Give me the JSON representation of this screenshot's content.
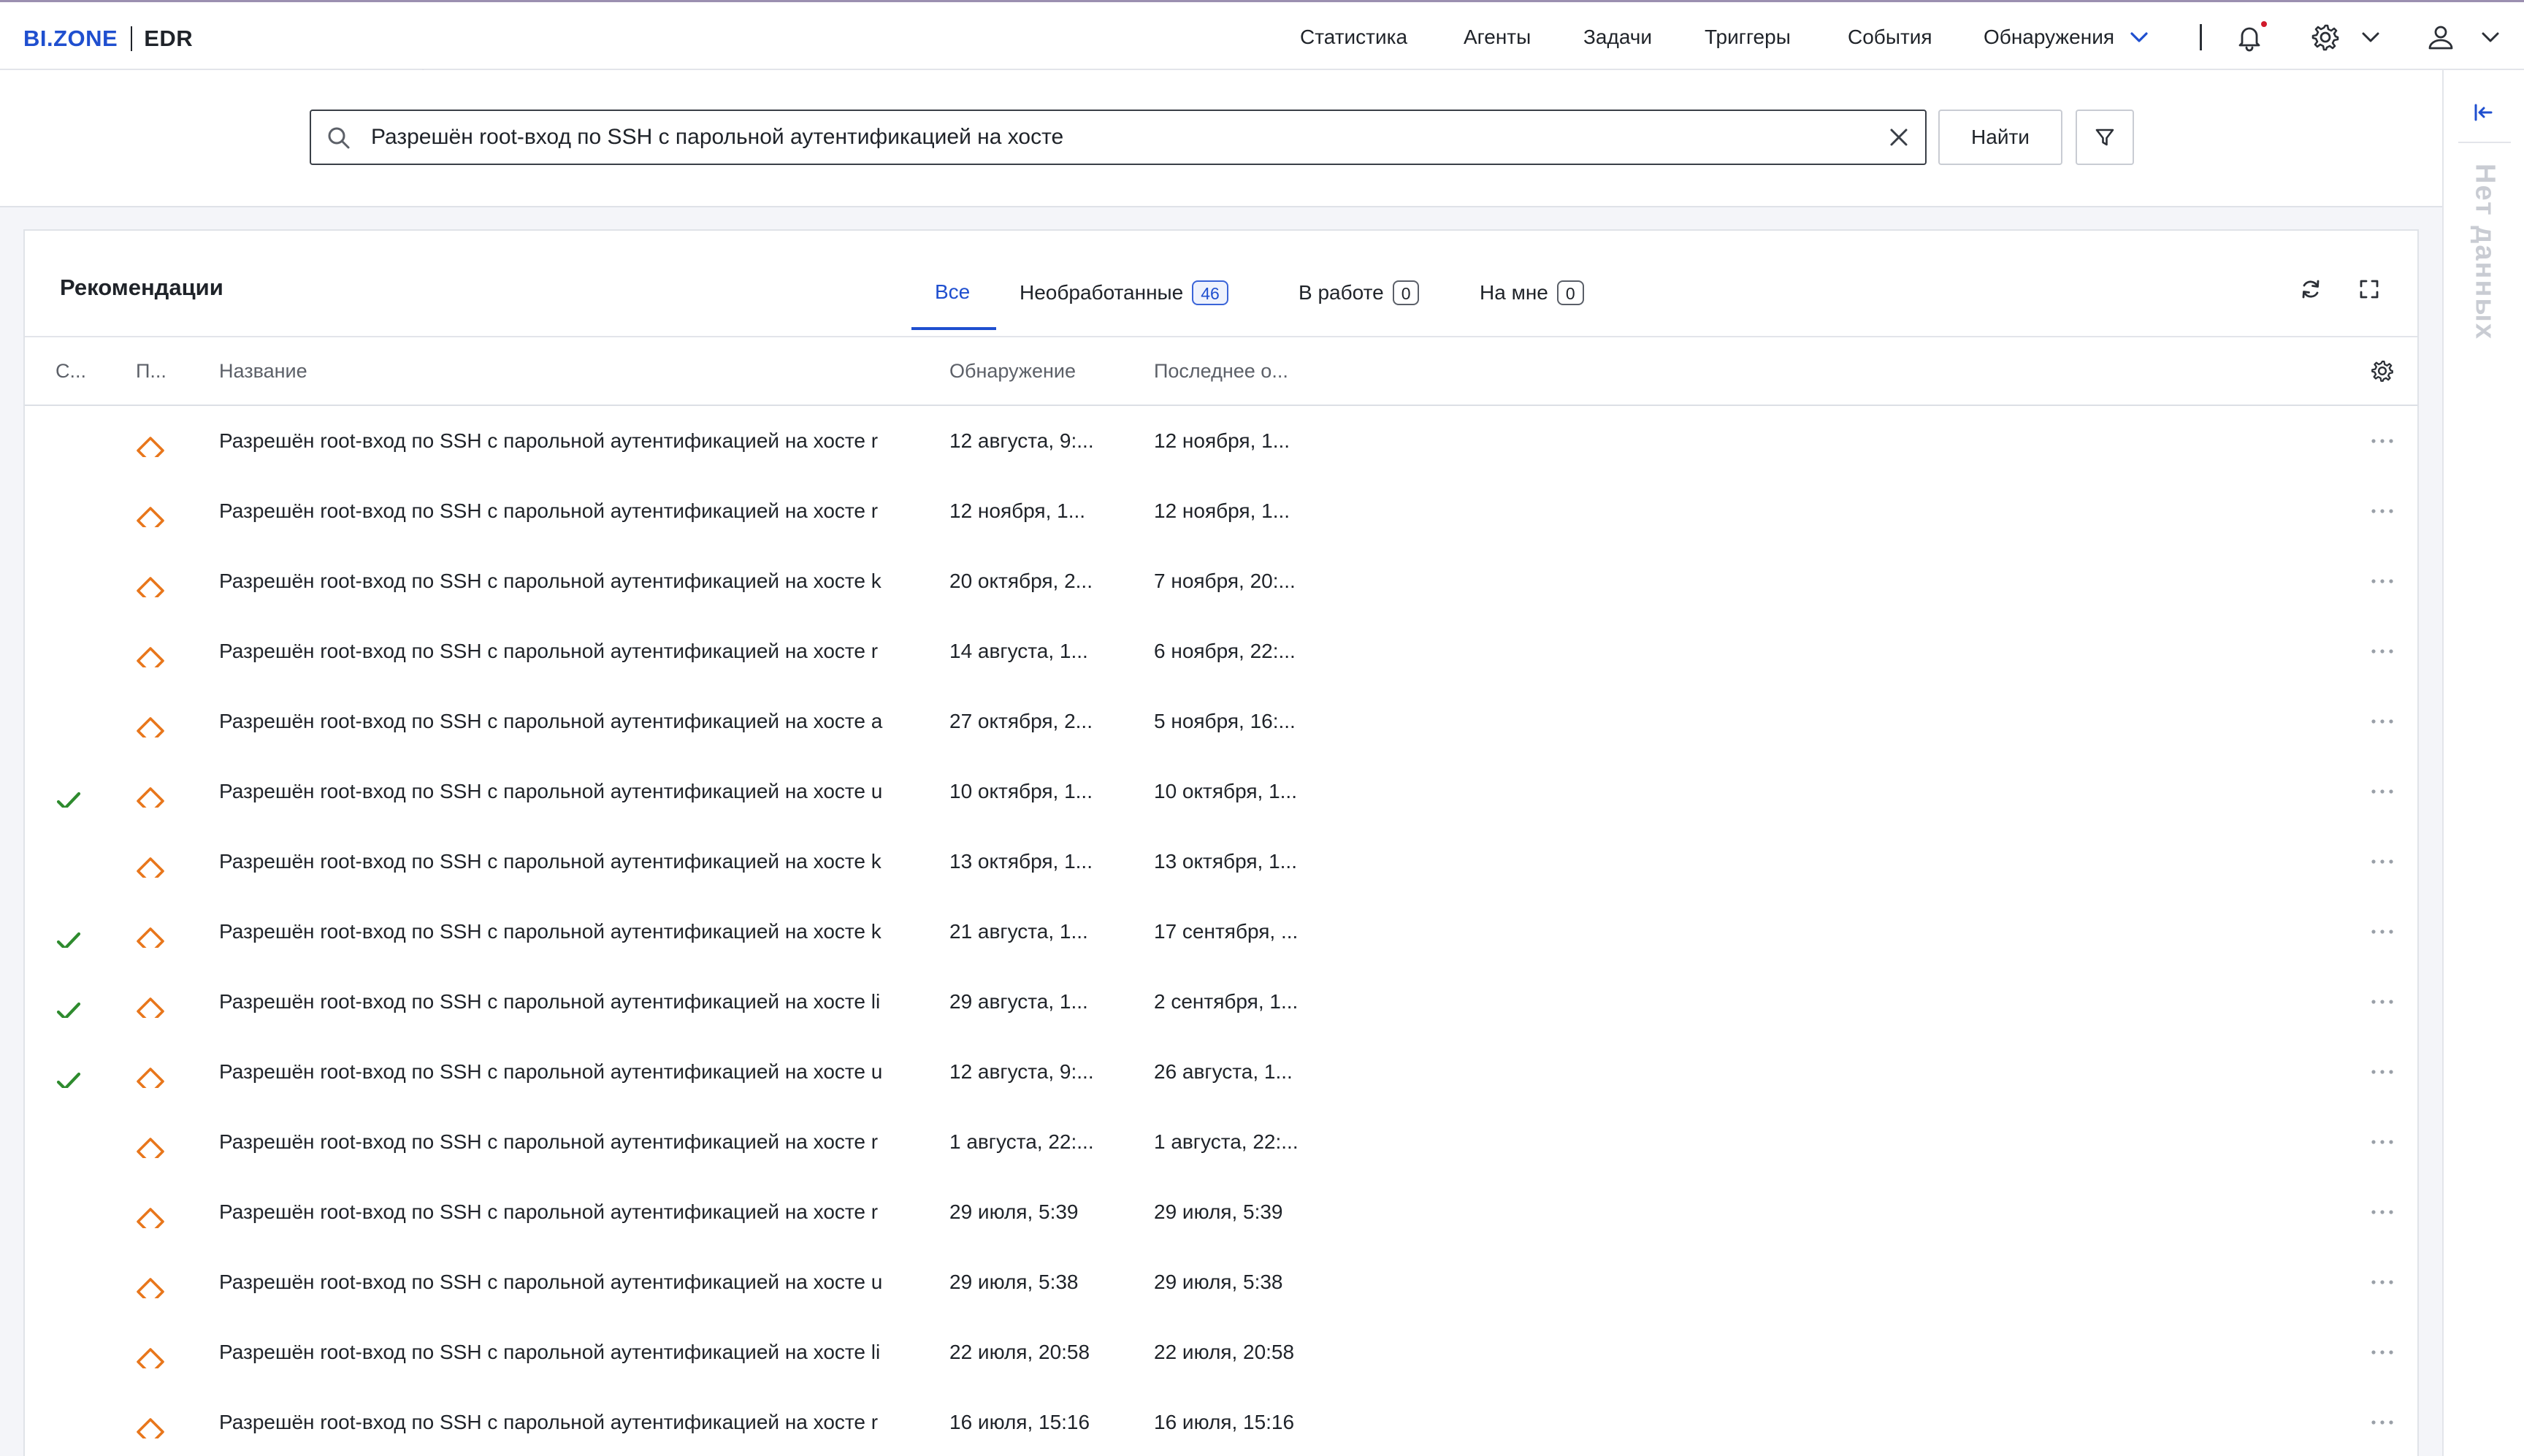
{
  "header": {
    "brand": "BI.ZONE",
    "product": "EDR",
    "nav": [
      "Статистика",
      "Агенты",
      "Задачи",
      "Триггеры",
      "События",
      "Обнаружения"
    ],
    "active_nav": "Обнаружения",
    "icons": [
      "chevron-down-icon",
      "bell-icon",
      "gear-icon",
      "user-icon"
    ]
  },
  "search": {
    "value": "Разрешён root-вход по SSH с парольной аутентификацией на хосте",
    "find_label": "Найти"
  },
  "side_panel": {
    "empty_label": "Нет данных"
  },
  "card": {
    "title": "Рекомендации",
    "tabs": [
      {
        "label": "Все",
        "count": null
      },
      {
        "label": "Необработанные",
        "count": "46"
      },
      {
        "label": "В работе",
        "count": "0"
      },
      {
        "label": "На мне",
        "count": "0"
      }
    ],
    "active_tab": "Все"
  },
  "table": {
    "columns": [
      "С...",
      "П...",
      "Название",
      "Обнаружение",
      "Последнее о..."
    ],
    "rows": [
      {
        "checked": false,
        "name": "Разрешён root-вход по SSH с парольной аутентификацией на хосте r",
        "detected": "12 августа, 9:...",
        "last": "12 ноября, 1..."
      },
      {
        "checked": false,
        "name": "Разрешён root-вход по SSH с парольной аутентификацией на хосте r",
        "detected": "12 ноября, 1...",
        "last": "12 ноября, 1..."
      },
      {
        "checked": false,
        "name": "Разрешён root-вход по SSH с парольной аутентификацией на хосте k",
        "detected": "20 октября, 2...",
        "last": "7 ноября, 20:..."
      },
      {
        "checked": false,
        "name": "Разрешён root-вход по SSH с парольной аутентификацией на хосте r",
        "detected": "14 августа, 1...",
        "last": "6 ноября, 22:..."
      },
      {
        "checked": false,
        "name": "Разрешён root-вход по SSH с парольной аутентификацией на хосте a",
        "detected": "27 октября, 2...",
        "last": "5 ноября, 16:..."
      },
      {
        "checked": true,
        "name": "Разрешён root-вход по SSH с парольной аутентификацией на хосте u",
        "detected": "10 октября, 1...",
        "last": "10 октября, 1..."
      },
      {
        "checked": false,
        "name": "Разрешён root-вход по SSH с парольной аутентификацией на хосте k",
        "detected": "13 октября, 1...",
        "last": "13 октября, 1..."
      },
      {
        "checked": true,
        "name": "Разрешён root-вход по SSH с парольной аутентификацией на хосте k",
        "detected": "21 августа, 1...",
        "last": "17 сентября, ..."
      },
      {
        "checked": true,
        "name": "Разрешён root-вход по SSH с парольной аутентификацией на хосте li",
        "detected": "29 августа, 1...",
        "last": "2 сентября, 1..."
      },
      {
        "checked": true,
        "name": "Разрешён root-вход по SSH с парольной аутентификацией на хосте u",
        "detected": "12 августа, 9:...",
        "last": "26 августа, 1..."
      },
      {
        "checked": false,
        "name": "Разрешён root-вход по SSH с парольной аутентификацией на хосте r",
        "detected": "1 августа, 22:...",
        "last": "1 августа, 22:..."
      },
      {
        "checked": false,
        "name": "Разрешён root-вход по SSH с парольной аутентификацией на хосте r",
        "detected": "29 июля, 5:39",
        "last": "29 июля, 5:39"
      },
      {
        "checked": false,
        "name": "Разрешён root-вход по SSH с парольной аутентификацией на хосте u",
        "detected": "29 июля, 5:38",
        "last": "29 июля, 5:38"
      },
      {
        "checked": false,
        "name": "Разрешён root-вход по SSH с парольной аутентификацией на хосте li",
        "detected": "22 июля, 20:58",
        "last": "22 июля, 20:58"
      },
      {
        "checked": false,
        "name": "Разрешён root-вход по SSH с парольной аутентификацией на хосте r",
        "detected": "16 июля, 15:16",
        "last": "16 июля, 15:16"
      }
    ]
  },
  "colors": {
    "accent": "#1f4fcf",
    "priority": "#e8761b",
    "check": "#2e8b2e",
    "notification": "#d0192b"
  }
}
